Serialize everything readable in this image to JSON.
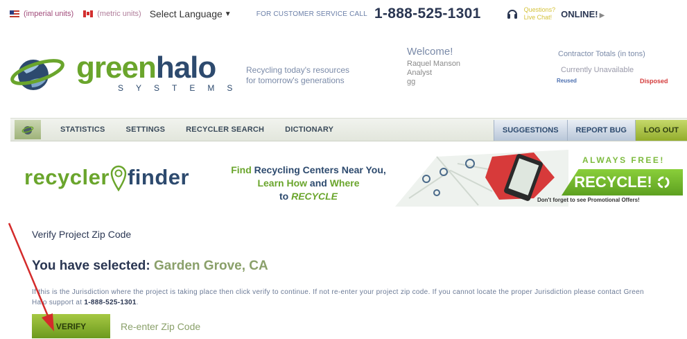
{
  "topbar": {
    "imperial_label": "(imperial units)",
    "metric_label": "(metric units)",
    "language_label": "Select Language",
    "language_caret": "▼",
    "cs_label": "FOR CUSTOMER SERVICE CALL",
    "cs_phone": "1-888-525-1301",
    "chat_line1": "Questions?",
    "chat_line2": "Live Chat!",
    "online_label": "ONLINE!",
    "online_arrow": "▶"
  },
  "header": {
    "brand_green": "green",
    "brand_dark": "halo",
    "brand_sub": "SYSTEMS",
    "tagline_line1": "Recycling today's resources",
    "tagline_line2": "for tomorrow's generations",
    "welcome": "Welcome!",
    "user_name": "Raquel Manson",
    "user_role": "Analyst",
    "user_code": "gg",
    "ctotals_label": "Contractor Totals (in tons)",
    "ctotals_value": "Currently Unavailable",
    "reused_label": "Reused",
    "disposed_label": "Disposed"
  },
  "nav": {
    "items": [
      "STATISTICS",
      "SETTINGS",
      "RECYCLER SEARCH",
      "DICTIONARY"
    ],
    "right": [
      "SUGGESTIONS",
      "REPORT BUG",
      "LOG OUT"
    ]
  },
  "banner": {
    "rf_part1": "recycler",
    "rf_part2": "finder",
    "tag_find": "Find ",
    "tag_centers": "Recycling Centers Near You,",
    "tag_learn": "Learn How",
    "tag_and": " and ",
    "tag_where": "Where",
    "tag_to": "to ",
    "tag_recycle": "RECYCLE",
    "always_free": "ALWAYS FREE!",
    "recycle_btn": "RECYCLE!",
    "promo": "Don't forget to see Promotional Offers!"
  },
  "main": {
    "title": "Verify Project Zip Code",
    "selected_prefix": "You have selected: ",
    "selected_city": "Garden Grove, CA",
    "instructions_1": "If this is the Jurisdiction where the project is taking place then click verify to continue. If not re-enter your project zip code. If you cannot locate the proper Jurisdiction please contact Green Halo support at ",
    "instructions_phone": "1-888-525-1301",
    "instructions_end": ".",
    "verify_label": "VERIFY",
    "reenter_label": "Re-enter Zip Code"
  },
  "colors": {
    "brand_green": "#6aa52c",
    "brand_navy": "#2d4a6e",
    "annotation_red": "#d42b2b"
  }
}
